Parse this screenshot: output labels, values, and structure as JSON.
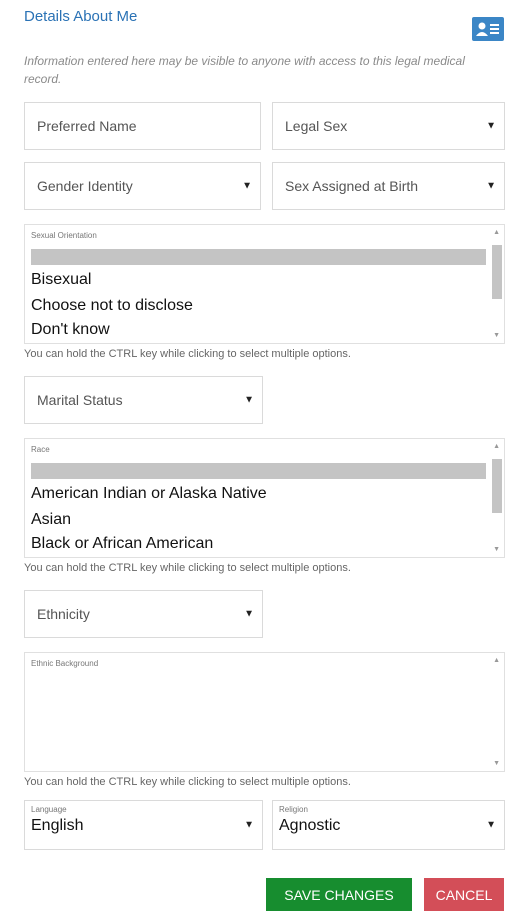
{
  "section_title": "Details About Me",
  "disclaimer": "Information entered here may be visible to anyone with access to this legal medical record.",
  "fields": {
    "preferred_name": "Preferred Name",
    "legal_sex": "Legal Sex",
    "gender_identity": "Gender Identity",
    "sex_assigned_at_birth": "Sex Assigned at Birth",
    "marital_status": "Marital Status",
    "ethnicity": "Ethnicity"
  },
  "sexual_orientation": {
    "label": "Sexual Orientation",
    "options": [
      "Bisexual",
      "Choose not to disclose",
      "Don't know"
    ]
  },
  "race": {
    "label": "Race",
    "options": [
      "American Indian or Alaska Native",
      "Asian",
      "Black or African American"
    ]
  },
  "ethnic_background": {
    "label": "Ethnic Background"
  },
  "multi_select_hint": "You can hold the CTRL key while clicking to select multiple options.",
  "language": {
    "label": "Language",
    "value": "English"
  },
  "religion": {
    "label": "Religion",
    "value": "Agnostic"
  },
  "buttons": {
    "save": "SAVE CHANGES",
    "cancel": "CANCEL"
  },
  "icons": {
    "contact_card": "contact-card-icon",
    "caret": "caret-down-icon"
  },
  "colors": {
    "title": "#2a72b5",
    "save": "#178d2f",
    "cancel": "#d34e58",
    "icon_bg": "#3b86c6"
  }
}
